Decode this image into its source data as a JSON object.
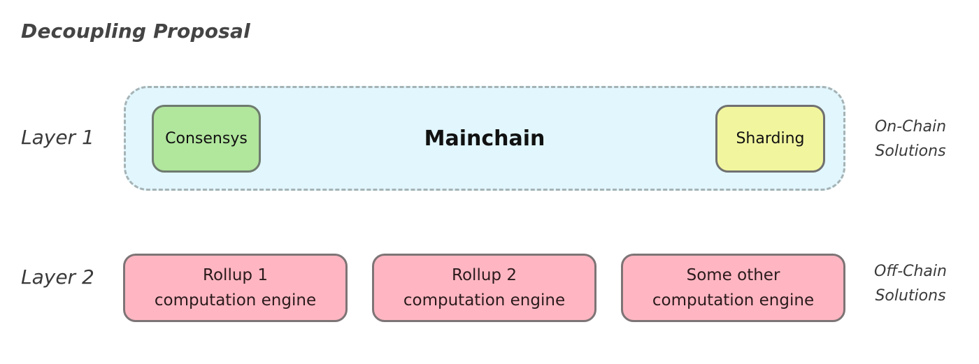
{
  "title": "Decoupling Proposal",
  "layers": [
    {
      "label": "Layer 1",
      "side_label_line1": "On-Chain",
      "side_label_line2": "Solutions",
      "container": {
        "title": "Mainchain",
        "modules": [
          {
            "label": "Consensys",
            "color": "#b1e69d"
          },
          {
            "label": "Sharding",
            "color": "#f1f59e"
          }
        ]
      }
    },
    {
      "label": "Layer 2",
      "side_label_line1": "Off-Chain",
      "side_label_line2": "Solutions",
      "engines": [
        {
          "line1": "Rollup 1",
          "line2": "computation engine",
          "color": "#ffb6c2"
        },
        {
          "line1": "Rollup 2",
          "line2": "computation engine",
          "color": "#ffb6c2"
        },
        {
          "line1": "Some other",
          "line2": "computation engine",
          "color": "#ffb6c2"
        }
      ]
    }
  ],
  "colors": {
    "mainchain_bg": "#e1f6fd",
    "dashed_border": "#a6b3b5"
  }
}
